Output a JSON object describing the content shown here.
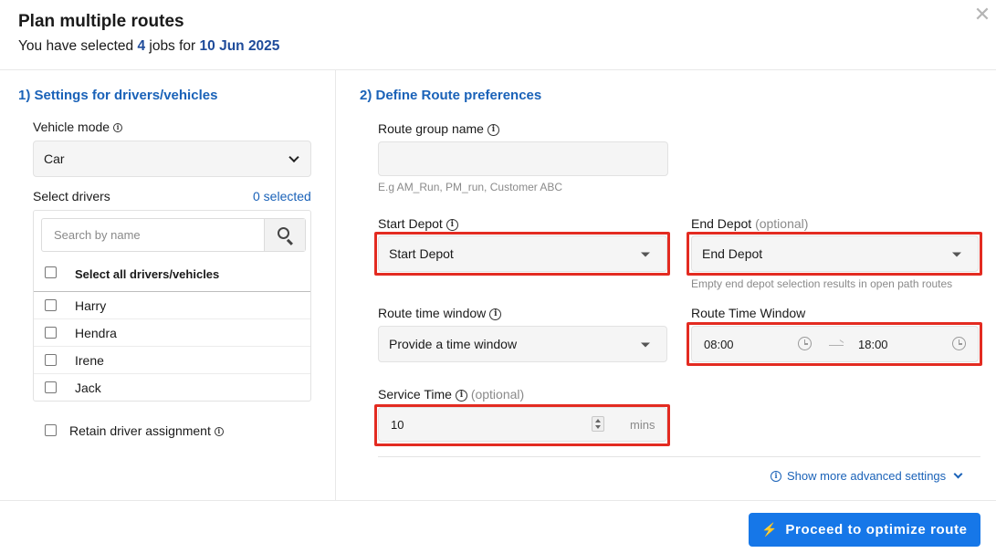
{
  "header": {
    "title": "Plan multiple routes",
    "subtitle_prefix": "You have selected",
    "job_count": "4",
    "subtitle_mid": "jobs for",
    "date": "10 Jun 2025",
    "close_icon": "close-icon"
  },
  "left": {
    "section_title": "1) Settings for drivers/vehicles",
    "vehicle_mode_label": "Vehicle mode",
    "vehicle_mode_value": "Car",
    "select_drivers_label": "Select drivers",
    "selected_count": "0 selected",
    "search_placeholder": "Search by name",
    "select_all_label": "Select all drivers/vehicles",
    "drivers": [
      "Harry",
      "Hendra",
      "Irene",
      "Jack"
    ],
    "retain_label": "Retain driver assignment"
  },
  "right": {
    "section_title": "2) Define Route preferences",
    "route_group_label": "Route group name",
    "route_group_value": "",
    "route_group_hint": "E.g AM_Run, PM_run, Customer ABC",
    "start_depot_label": "Start Depot",
    "start_depot_value": "Start Depot",
    "end_depot_label": "End Depot",
    "end_depot_optional": "(optional)",
    "end_depot_value": "End Depot",
    "end_depot_hint": "Empty end depot selection results in open path routes",
    "route_time_window_label": "Route time window",
    "route_time_window_value": "Provide a time window",
    "route_time_window_label2": "Route Time Window",
    "time_start": "08:00",
    "time_end": "18:00",
    "service_time_label": "Service Time",
    "service_time_optional": "(optional)",
    "service_time_value": "10",
    "service_time_unit": "mins",
    "advanced_link": "Show more advanced settings"
  },
  "footer": {
    "proceed_label": "Proceed to optimize route"
  },
  "colors": {
    "accent": "#1a62b8",
    "primary_button": "#1677e8",
    "highlight_box": "#e32b21"
  }
}
